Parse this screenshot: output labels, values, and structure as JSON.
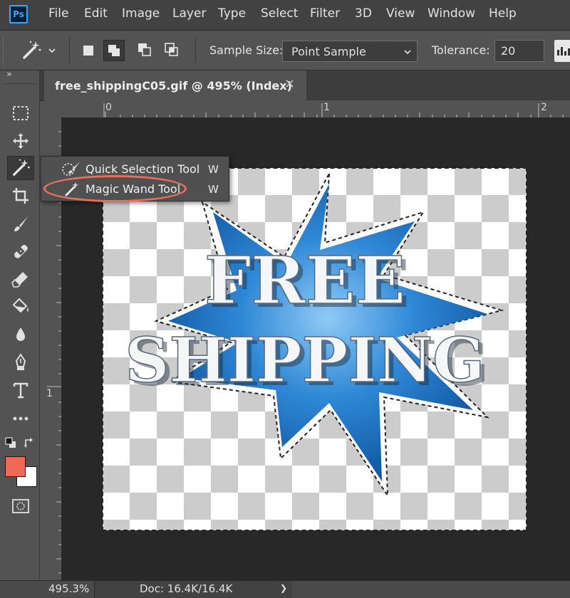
{
  "app": {
    "logo": "Ps"
  },
  "menu": [
    "File",
    "Edit",
    "Image",
    "Layer",
    "Type",
    "Select",
    "Filter",
    "3D",
    "View",
    "Window",
    "Help"
  ],
  "options": {
    "sample_size_label": "Sample Size:",
    "sample_size_value": "Point Sample",
    "tolerance_label": "Tolerance:",
    "tolerance_value": "20"
  },
  "tab": {
    "title": "free_shippingC05.gif @ 495% (Index)",
    "close": "×"
  },
  "rulers": {
    "top": [
      "0",
      "1",
      "2"
    ],
    "left": [
      "1"
    ]
  },
  "flyout": {
    "items": [
      {
        "label": "Quick Selection Tool",
        "shortcut": "W"
      },
      {
        "label": "Magic Wand Tool",
        "shortcut": "W"
      }
    ]
  },
  "canvas_art": {
    "line1": "FREE",
    "line2": "SHIPPING"
  },
  "status": {
    "zoom": "495.3%",
    "doc": "Doc: 16.4K/16.4K",
    "arrow": "❯"
  },
  "colors": {
    "foreground": "#ee6a55",
    "background": "#ffffff",
    "highlight_ring": "#e8705a",
    "starburst": "#2f88d6"
  },
  "toolbar_collapse": "»"
}
